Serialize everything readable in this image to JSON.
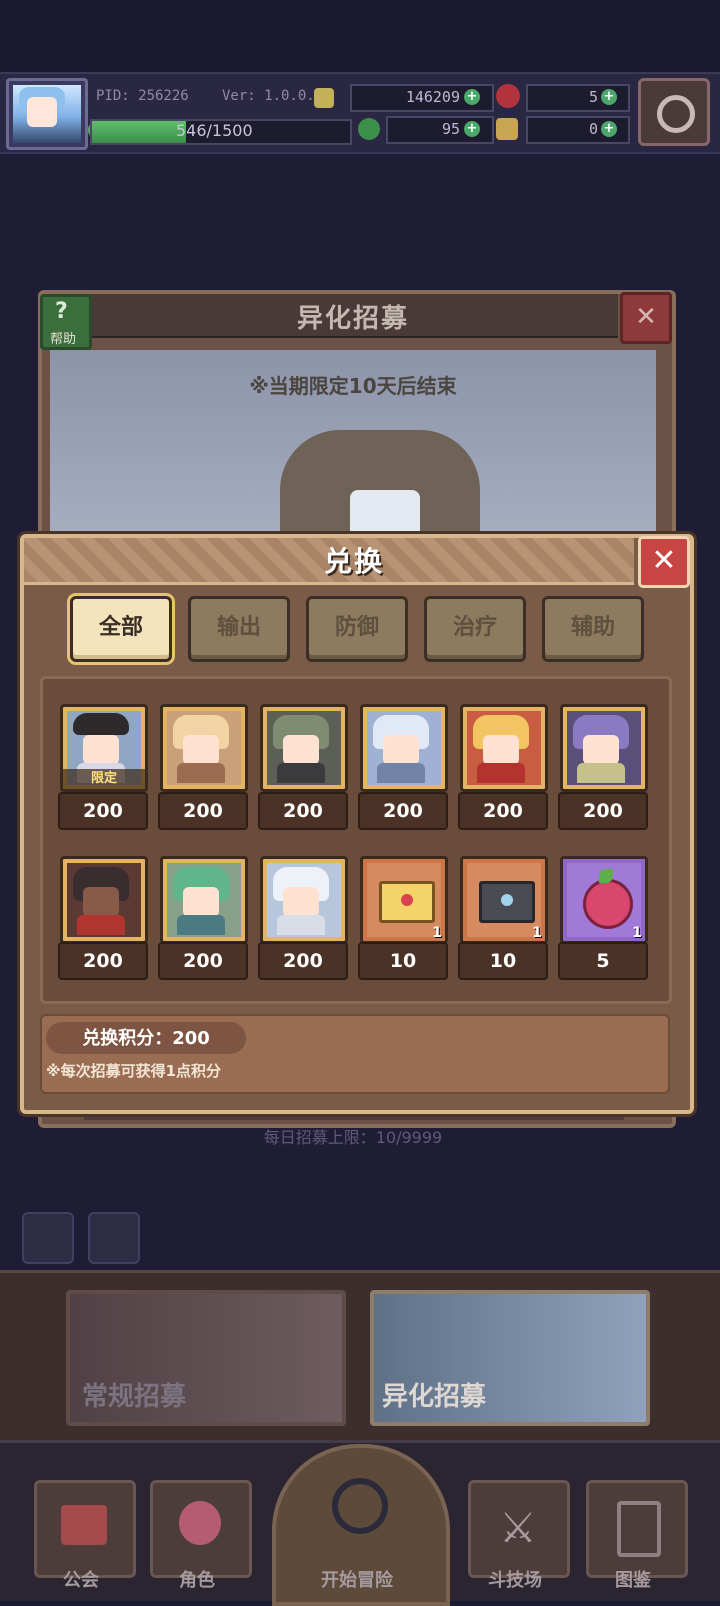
{
  "header": {
    "pid": "PID: 256226",
    "version": "Ver: 1.0.0.5",
    "xp": "546/1500",
    "xp_progress": 0.364,
    "currency1": "146209",
    "currency2": "5",
    "currency3": "95",
    "currency4": "0"
  },
  "recruit": {
    "help_label": "帮助",
    "title": "异化招募",
    "note": "※当期限定10天后结束",
    "daily_limit": "每日招募上限：10/9999"
  },
  "exchange": {
    "title": "兑换",
    "close": "✕",
    "tabs": [
      {
        "label": "全部",
        "active": true
      },
      {
        "label": "输出",
        "active": false
      },
      {
        "label": "防御",
        "active": false
      },
      {
        "label": "治疗",
        "active": false
      },
      {
        "label": "辅助",
        "active": false
      }
    ],
    "items": [
      {
        "name": "witch-hero",
        "price": "200",
        "badge": "限定"
      },
      {
        "name": "blonde-hero",
        "price": "200"
      },
      {
        "name": "green-hair-hero",
        "price": "200"
      },
      {
        "name": "silver-armor-hero",
        "price": "200"
      },
      {
        "name": "red-blonde-hero",
        "price": "200"
      },
      {
        "name": "purple-hair-hero",
        "price": "200"
      },
      {
        "name": "dark-hat-hero",
        "price": "200"
      },
      {
        "name": "green-long-hair-hero",
        "price": "200"
      },
      {
        "name": "white-hair-hero",
        "price": "200"
      },
      {
        "name": "gold-letter",
        "price": "10",
        "qty": "1"
      },
      {
        "name": "dark-letter",
        "price": "10",
        "qty": "1"
      },
      {
        "name": "pink-fruit",
        "price": "5",
        "qty": "1"
      }
    ],
    "points_label": "兑换积分：200",
    "points_note": "※每次招募可获得1点积分"
  },
  "banners": {
    "normal": "常规招募",
    "alien": "异化招募"
  },
  "nav": {
    "guild": "公会",
    "character": "角色",
    "adventure": "开始冒险",
    "arena": "斗技场",
    "gallery": "图鉴"
  },
  "colors": {
    "modal_bg": "#7a5b48",
    "modal_border": "#d7b78c",
    "close_red": "#c74542",
    "tab_active": "#f3e4bc",
    "xp_green": "#5fbf6b"
  }
}
